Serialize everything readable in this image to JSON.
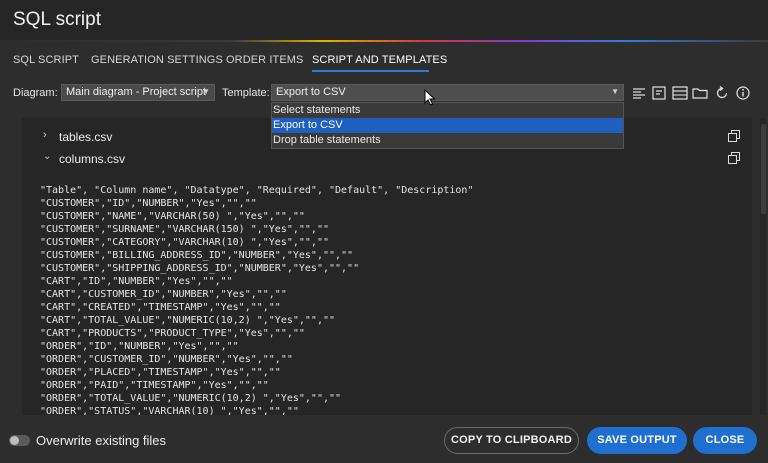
{
  "window": {
    "title": "SQL script"
  },
  "tabs": [
    {
      "label": "SQL SCRIPT"
    },
    {
      "label": "GENERATION SETTINGS"
    },
    {
      "label": "ORDER ITEMS"
    },
    {
      "label": "SCRIPT AND TEMPLATES"
    }
  ],
  "active_tab": "SCRIPT AND TEMPLATES",
  "toolbar": {
    "diagram_label": "Diagram:",
    "diagram_value": "Main diagram - Project script",
    "template_label": "Template:",
    "template_value": "Export to CSV",
    "icons": [
      "align-left-icon",
      "template-icon",
      "grid-icon",
      "folder-icon",
      "refresh-icon",
      "info-icon"
    ]
  },
  "template_dropdown": {
    "options": [
      "Select statements",
      "Export to CSV",
      "Drop table statements"
    ],
    "selected": "Export to CSV"
  },
  "files": [
    {
      "name": "tables.csv",
      "expanded": false
    },
    {
      "name": "columns.csv",
      "expanded": true
    }
  ],
  "code_lines": [
    "\"Table\", \"Column name\", \"Datatype\", \"Required\", \"Default\", \"Description\"",
    "\"CUSTOMER\",\"ID\",\"NUMBER\",\"Yes\",\"\",\"\"",
    "\"CUSTOMER\",\"NAME\",\"VARCHAR(50) \",\"Yes\",\"\",\"\"",
    "\"CUSTOMER\",\"SURNAME\",\"VARCHAR(150) \",\"Yes\",\"\",\"\"",
    "\"CUSTOMER\",\"CATEGORY\",\"VARCHAR(10) \",\"Yes\",\"\",\"\"",
    "\"CUSTOMER\",\"BILLING_ADDRESS_ID\",\"NUMBER\",\"Yes\",\"\",\"\"",
    "\"CUSTOMER\",\"SHIPPING_ADDRESS_ID\",\"NUMBER\",\"Yes\",\"\",\"\"",
    "\"CART\",\"ID\",\"NUMBER\",\"Yes\",\"\",\"\"",
    "\"CART\",\"CUSTOMER_ID\",\"NUMBER\",\"Yes\",\"\",\"\"",
    "\"CART\",\"CREATED\",\"TIMESTAMP\",\"Yes\",\"\",\"\"",
    "\"CART\",\"TOTAL_VALUE\",\"NUMERIC(10,2) \",\"Yes\",\"\",\"\"",
    "\"CART\",\"PRODUCTS\",\"PRODUCT_TYPE\",\"Yes\",\"\",\"\"",
    "\"ORDER\",\"ID\",\"NUMBER\",\"Yes\",\"\",\"\"",
    "\"ORDER\",\"CUSTOMER_ID\",\"NUMBER\",\"Yes\",\"\",\"\"",
    "\"ORDER\",\"PLACED\",\"TIMESTAMP\",\"Yes\",\"\",\"\"",
    "\"ORDER\",\"PAID\",\"TIMESTAMP\",\"Yes\",\"\",\"\"",
    "\"ORDER\",\"TOTAL_VALUE\",\"NUMERIC(10,2) \",\"Yes\",\"\",\"\"",
    "\"ORDER\",\"STATUS\",\"VARCHAR(10) \",\"Yes\",\"\",\"\""
  ],
  "footer": {
    "overwrite_label": "Overwrite existing files",
    "overwrite_checked": false,
    "copy_label": "COPY TO CLIPBOARD",
    "save_label": "SAVE OUTPUT",
    "close_label": "CLOSE"
  },
  "colors": {
    "accent": "#1e6fd0",
    "selection": "#1f5fbf",
    "background": "#2d2d2d"
  }
}
